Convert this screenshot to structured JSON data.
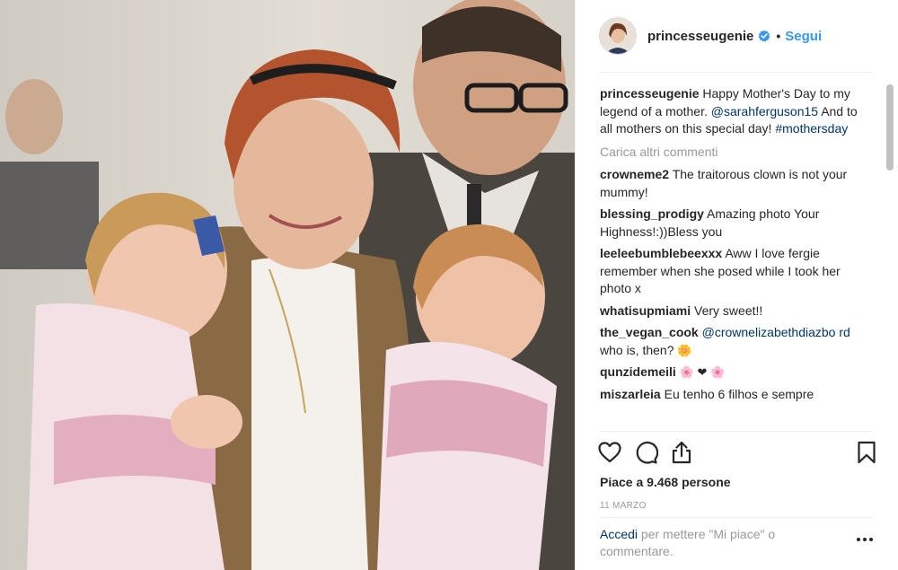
{
  "post": {
    "image_alt": "Photo of a woman holding two young children",
    "username": "princesseugenie",
    "dot": "•",
    "follow_label": "Segui",
    "caption": {
      "username": "princesseugenie",
      "text_1": "Happy Mother's Day to my legend of a mother.",
      "mention": "@sarahferguson15",
      "text_2": "And to all mothers on this special day!",
      "hashtag": "#mothersday"
    },
    "load_more_label": "Carica altri commenti",
    "comments": [
      {
        "user": "crowneme2",
        "text": "The traitorous clown is not your mummy!"
      },
      {
        "user": "blessing_prodigy",
        "text": "Amazing photo Your Highness!:))Bless you"
      },
      {
        "user": "leeleebumblebeexxx",
        "text": "Aww I love fergie remember when she posed while I took her photo x"
      },
      {
        "user": "whatisupmiami",
        "text": "Very sweet!!"
      },
      {
        "user": "the_vegan_cook",
        "mention": "@crownelizabethdiazbo rd",
        "text": "who is, then?",
        "emoji": "🌼"
      },
      {
        "user": "qunzidemeili",
        "text": "🌸 ❤ 🌸"
      },
      {
        "user": "miszarleia",
        "text": "Eu tenho 6 filhos e sempre"
      }
    ],
    "likes_text": "Piace a 9.468 persone",
    "date_text": "11 MARZO",
    "login": {
      "link_label": "Accedi",
      "text": "per mettere \"Mi piace\" o commentare."
    },
    "icons": {
      "like": "heart-icon",
      "comment": "comment-bubble-icon",
      "share": "share-icon",
      "save": "bookmark-icon",
      "more": "more-options-icon",
      "verified": "verified-badge-icon"
    },
    "colors": {
      "link": "#003569",
      "follow": "#3897f0",
      "verified": "#3897f0",
      "muted": "#999999"
    }
  }
}
